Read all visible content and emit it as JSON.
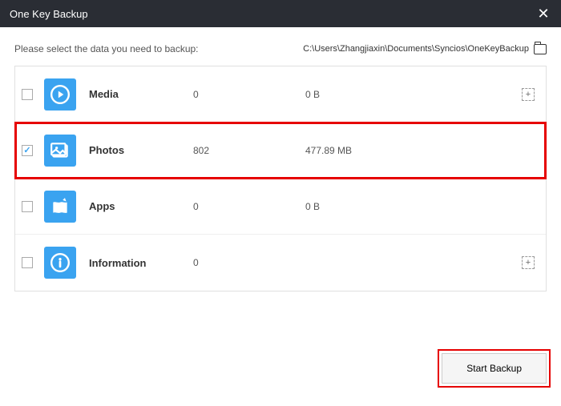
{
  "window": {
    "title": "One Key Backup"
  },
  "prompt": "Please select the data you need to backup:",
  "path": "C:\\Users\\Zhangjiaxin\\Documents\\Syncios\\OneKeyBackup",
  "items": [
    {
      "name": "Media",
      "count": "0",
      "size": "0 B",
      "checked": false,
      "hasAdd": true,
      "icon": "play"
    },
    {
      "name": "Photos",
      "count": "802",
      "size": "477.89 MB",
      "checked": true,
      "hasAdd": false,
      "icon": "photo",
      "highlighted": true
    },
    {
      "name": "Apps",
      "count": "0",
      "size": "0 B",
      "checked": false,
      "hasAdd": false,
      "icon": "apps"
    },
    {
      "name": "Information",
      "count": "0",
      "size": "",
      "checked": false,
      "hasAdd": true,
      "icon": "info"
    }
  ],
  "actions": {
    "start": "Start Backup"
  }
}
